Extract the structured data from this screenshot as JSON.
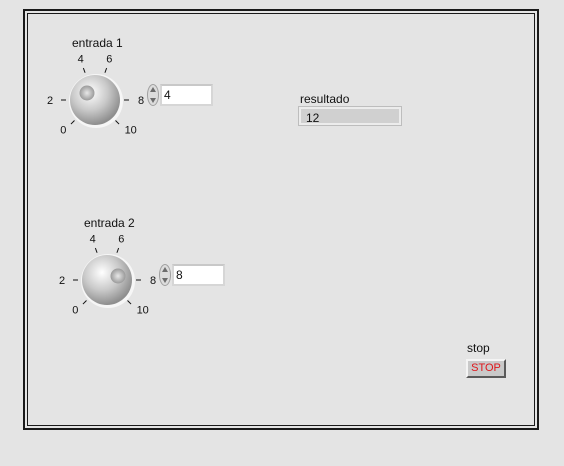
{
  "controls": {
    "knob1": {
      "label": "entrada 1",
      "value": "4",
      "numeric_value": 4,
      "ticks": [
        "0",
        "2",
        "4",
        "6",
        "8",
        "10"
      ],
      "min": 0,
      "max": 10
    },
    "knob2": {
      "label": "entrada 2",
      "value": "8",
      "numeric_value": 8,
      "ticks": [
        "0",
        "2",
        "4",
        "6",
        "8",
        "10"
      ],
      "min": 0,
      "max": 10
    },
    "result": {
      "label": "resultado",
      "value": "12"
    },
    "stop": {
      "label": "stop",
      "button_text": "STOP",
      "text_color": "#e0161b"
    }
  }
}
